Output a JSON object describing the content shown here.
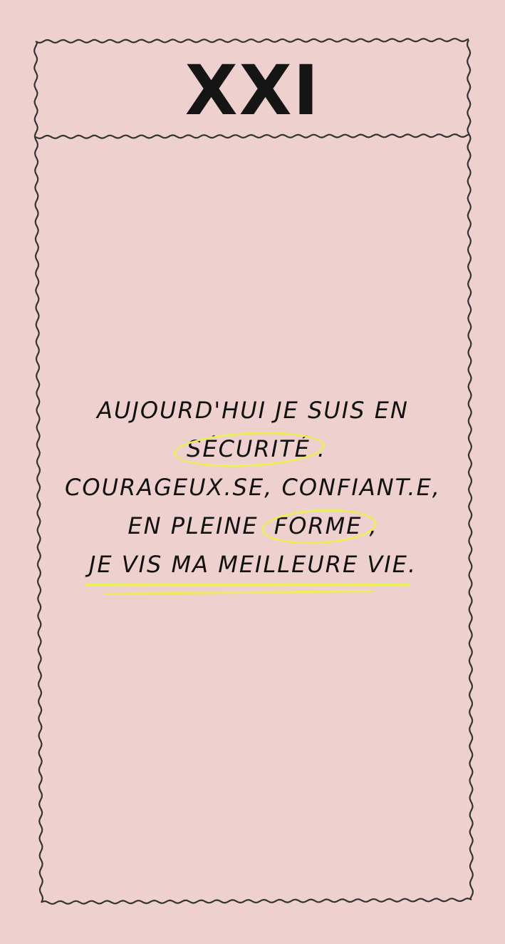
{
  "card": {
    "title": "XXI",
    "affirmation": {
      "line1": "AUJOURD'HUI JE SUIS EN",
      "line2_highlight": "SÉCURITÉ",
      "line2_after": ".",
      "line3": "COURAGEUX.SE, CONFIANT.E,",
      "line4_before": "EN PLEINE",
      "line4_highlight": "FORME",
      "line4_after": ",",
      "line5": "JE VIS MA MEILLEURE VIE."
    }
  },
  "colors": {
    "background": "#EED1CE",
    "ink": "#151515",
    "highlight": "#E9EE59"
  }
}
